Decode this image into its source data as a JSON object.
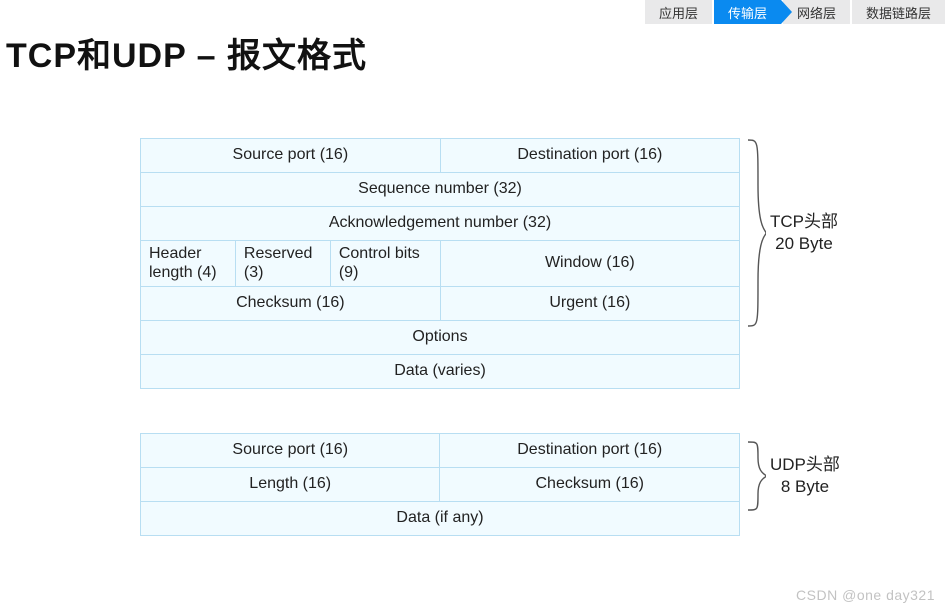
{
  "tabs": {
    "app": "应用层",
    "transport": "传输层",
    "network": "网络层",
    "datalink": "数据链路层"
  },
  "title": "TCP和UDP – 报文格式",
  "tcp": {
    "source_port": "Source port (16)",
    "dest_port": "Destination port (16)",
    "seq": "Sequence number (32)",
    "ack": "Acknowledgement number (32)",
    "hlen": "Header length (4)",
    "reserved": "Reserved (3)",
    "control": "Control bits (9)",
    "window": "Window (16)",
    "checksum": "Checksum (16)",
    "urgent": "Urgent (16)",
    "options": "Options",
    "data": "Data (varies)",
    "brace_label1": "TCP头部",
    "brace_label2": "20 Byte"
  },
  "udp": {
    "source_port": "Source port (16)",
    "dest_port": "Destination port (16)",
    "length": "Length (16)",
    "checksum": "Checksum (16)",
    "data": "Data (if any)",
    "brace_label1": "UDP头部",
    "brace_label2": "8 Byte"
  },
  "watermark": "CSDN @one day321",
  "chart_data": [
    {
      "type": "table",
      "title": "TCP Header Format",
      "header_size_bytes": 20,
      "fields": [
        {
          "name": "Source port",
          "bits": 16
        },
        {
          "name": "Destination port",
          "bits": 16
        },
        {
          "name": "Sequence number",
          "bits": 32
        },
        {
          "name": "Acknowledgement number",
          "bits": 32
        },
        {
          "name": "Header length",
          "bits": 4
        },
        {
          "name": "Reserved",
          "bits": 3
        },
        {
          "name": "Control bits",
          "bits": 9
        },
        {
          "name": "Window",
          "bits": 16
        },
        {
          "name": "Checksum",
          "bits": 16
        },
        {
          "name": "Urgent",
          "bits": 16
        },
        {
          "name": "Options",
          "bits": null
        },
        {
          "name": "Data (varies)",
          "bits": null
        }
      ]
    },
    {
      "type": "table",
      "title": "UDP Header Format",
      "header_size_bytes": 8,
      "fields": [
        {
          "name": "Source port",
          "bits": 16
        },
        {
          "name": "Destination port",
          "bits": 16
        },
        {
          "name": "Length",
          "bits": 16
        },
        {
          "name": "Checksum",
          "bits": 16
        },
        {
          "name": "Data (if any)",
          "bits": null
        }
      ]
    }
  ]
}
